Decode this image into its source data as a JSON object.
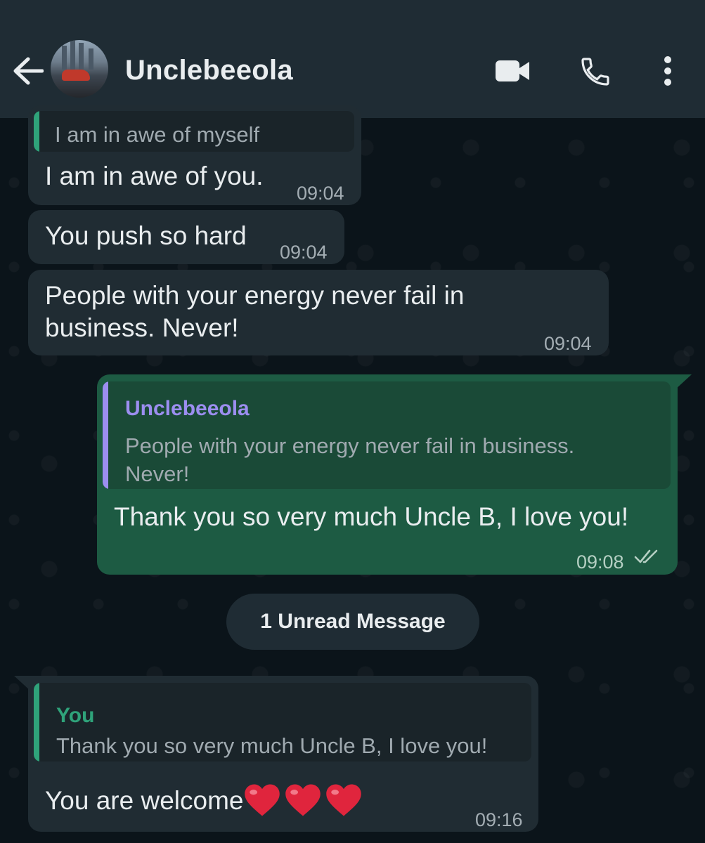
{
  "header": {
    "contact_name": "Unclebeeola",
    "icons": [
      "back-arrow-icon",
      "avatar",
      "video-call-icon",
      "voice-call-icon",
      "more-options-icon"
    ]
  },
  "colors": {
    "header_bg": "#1f2c34",
    "chat_bg": "#0b141a",
    "incoming_bubble": "#202c33",
    "outgoing_bubble": "#1d5b43",
    "quote_name_contact": "#9c8ef0",
    "quote_name_you": "#2fa37a",
    "heart": "#e0253d"
  },
  "messages": [
    {
      "direction": "in",
      "quote_text": "I am in awe of myself",
      "text": "I am in awe of you.",
      "time": "09:04"
    },
    {
      "direction": "in",
      "text": "You push so hard",
      "time": "09:04"
    },
    {
      "direction": "in",
      "text_line1": "People with your energy never fail in",
      "text_line2": "business. Never!",
      "time": "09:04"
    },
    {
      "direction": "out",
      "quote_name": "Unclebeeola",
      "quote_line1": "People with your energy never fail in business.",
      "quote_line2": "Never!",
      "text": "Thank you so very much Uncle B, I love you!",
      "time": "09:08",
      "status_icon": "double-check-icon"
    },
    {
      "direction": "in",
      "quote_name": "You",
      "quote_text": "Thank you so very much Uncle B, I love you!",
      "text": "You are welcome",
      "emoji": "❤️❤️❤️",
      "time": "09:16"
    }
  ],
  "unread_divider": "1 Unread Message"
}
